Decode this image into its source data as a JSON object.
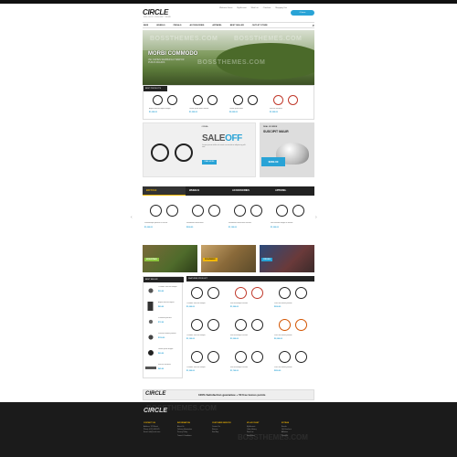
{
  "header": {
    "logo": "CIRCLE",
    "tagline": "BIKE SHOP OPENCART THEME",
    "top_links": [
      "Welcome Guest",
      "My Account",
      "Wish List",
      "Checkout",
      "Shopping Cart"
    ],
    "cart_label": "0 Items"
  },
  "nav": {
    "items": [
      "Bike",
      "Wheels",
      "Pedals",
      "Accessories",
      "Apparel",
      "Best Seller",
      "Outlet Store"
    ]
  },
  "hero": {
    "title": "MORBI COMMODO",
    "subtitle": "VEL SAPIEN SEMPER EU TEMPOR PURUS MAURIS",
    "watermark": "BOSSTHEMES.COM"
  },
  "strip": {
    "title": "BEST PRODUCTS",
    "items": [
      {
        "name": "Aliquet facilisis aliquet feugiat",
        "price": "$1,000.00"
      },
      {
        "name": "Lorem ipsum dolor facilisis",
        "price": "$1,200.00"
      },
      {
        "name": "Lorem ipsum dolor",
        "price": "$2,000.00"
      },
      {
        "name": "Sed nec tincidunt",
        "price": "$1,500.00"
      }
    ]
  },
  "sale": {
    "brand": "ORBEA",
    "title_a": "SALE",
    "title_b": "OFF",
    "subtitle": "Lorem ipsum dolor sit amet consectetur adipiscing elit sed",
    "button": "READ MORE"
  },
  "deal": {
    "label": "DEAL OF WEEK",
    "title": "SUSCIPIT MAUR",
    "price": "$080.00"
  },
  "tabs": [
    "Bicycle",
    "Wheels",
    "Accessories",
    "Apparel"
  ],
  "tab_products": [
    {
      "name": "Pellentesque placerat ut mauris",
      "price": "$1,000.00"
    },
    {
      "name": "Vestibulum consectetur",
      "price": "$900.00"
    },
    {
      "name": "Vestibulum consectetur facilisis",
      "price": "$1,100.00"
    },
    {
      "name": "Non molestie magna in mauris",
      "price": "$1,300.00"
    }
  ],
  "arrows": {
    "left": "‹",
    "right": "›"
  },
  "promos": [
    {
      "tag": "MOUNTAIN",
      "color": "#8dc63f"
    },
    {
      "tag": "ROADBIKE",
      "color": "#f2b705"
    },
    {
      "tag": "CROSS",
      "color": "#29a3d6"
    }
  ],
  "bestseller": {
    "title": "BEST SELLER",
    "items": [
      {
        "name": "Curabitur non velit tempor",
        "price": "$90.00"
      },
      {
        "name": "Aliquet facilisis aliquet",
        "price": "$80.00"
      },
      {
        "name": "Phasellus posuere",
        "price": "$72.00"
      },
      {
        "name": "Praesent finibus pulvinar",
        "price": "$150.00"
      },
      {
        "name": "Lorem ipsum feugiat",
        "price": "$60.00"
      },
      {
        "name": "Sed nec tincidunt",
        "price": "$45.00"
      }
    ]
  },
  "featured": {
    "title": "FEATURED PRODUCT",
    "items": [
      {
        "name": "Curabitur non velit tempor",
        "price": "$1,000.00"
      },
      {
        "name": "Sed scelerisque facilisis",
        "price": "$1,200.00"
      },
      {
        "name": "Proin vel mauris pretium",
        "price": "$900.00"
      },
      {
        "name": "Curabitur non velit tempor",
        "price": "$1,100.00"
      },
      {
        "name": "Sed scelerisque facilisis",
        "price": "$1,500.00"
      },
      {
        "name": "Proin vel mauris pretium",
        "price": "$2,000.00"
      },
      {
        "name": "Curabitur non velit tempor",
        "price": "$1,300.00"
      },
      {
        "name": "Sed scelerisque facilisis",
        "price": "$1,700.00"
      },
      {
        "name": "Proin vel mauris pretium",
        "price": "$950.00"
      }
    ]
  },
  "guarantee": {
    "logo": "CIRCLE",
    "text": "100% Satisfaction guarantee + 50 free bonus points"
  },
  "footer": {
    "logo": "CIRCLE",
    "watermark": "BOSSTHEMES.COM",
    "columns": [
      {
        "title": "CONTACT US",
        "lines": [
          "Address: 123 Street",
          "Phone: (012) 345 678",
          "Email: info@circle.com"
        ]
      },
      {
        "title": "INFORMATION",
        "lines": [
          "About Us",
          "Delivery Information",
          "Privacy Policy",
          "Terms & Conditions"
        ]
      },
      {
        "title": "CUSTOMER SERVICE",
        "lines": [
          "Contact Us",
          "Returns",
          "Site Map"
        ]
      },
      {
        "title": "MY ACCOUNT",
        "lines": [
          "My Account",
          "Order History",
          "Wish List",
          "Newsletter"
        ]
      },
      {
        "title": "EXTRAS",
        "lines": [
          "Brands",
          "Gift Vouchers",
          "Affiliates",
          "Specials"
        ]
      }
    ]
  },
  "colors": {
    "accent": "#29a3d6",
    "dark": "#222222",
    "highlight": "#f2b705"
  }
}
